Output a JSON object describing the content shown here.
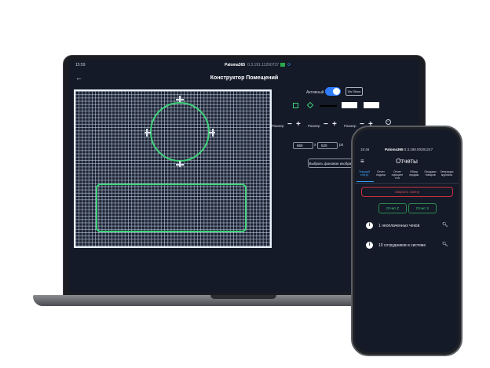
{
  "laptop": {
    "status_time": "15:59",
    "app_name": "Paloma365",
    "version": "0.3.191.11200737",
    "page_title": "Конструктор Помещений",
    "active_label": "Активный",
    "toggle_on": true,
    "small_button": "Vis Show",
    "size_label": "Размер",
    "minus": "−",
    "plus": "+",
    "width_value": "650",
    "height_value": "520",
    "times": "x",
    "unit": "px",
    "bg_button": "Выбрать фоновое изображение"
  },
  "phone": {
    "status_time": "15:46",
    "app_name": "Paloma365",
    "version": "0.3.189.00281247",
    "title": "Отчеты",
    "tabs": [
      "Текущий статус",
      "Отчет подачи",
      "Отчет официте нта",
      "Обзор продаж",
      "Продажи товаров",
      "Операции журнала"
    ],
    "close_shift": "Закрыть смену",
    "report_z": "Отчет Z",
    "report_x": "Отчет X",
    "rows": [
      {
        "text": "1 неоплаченных чеков"
      },
      {
        "text": "10 сотрудников в системе"
      }
    ]
  },
  "colors": {
    "accent": "#3da7ff",
    "shape_stroke": "#3fd27a",
    "danger": "#c9303b",
    "background": "#141a28"
  }
}
